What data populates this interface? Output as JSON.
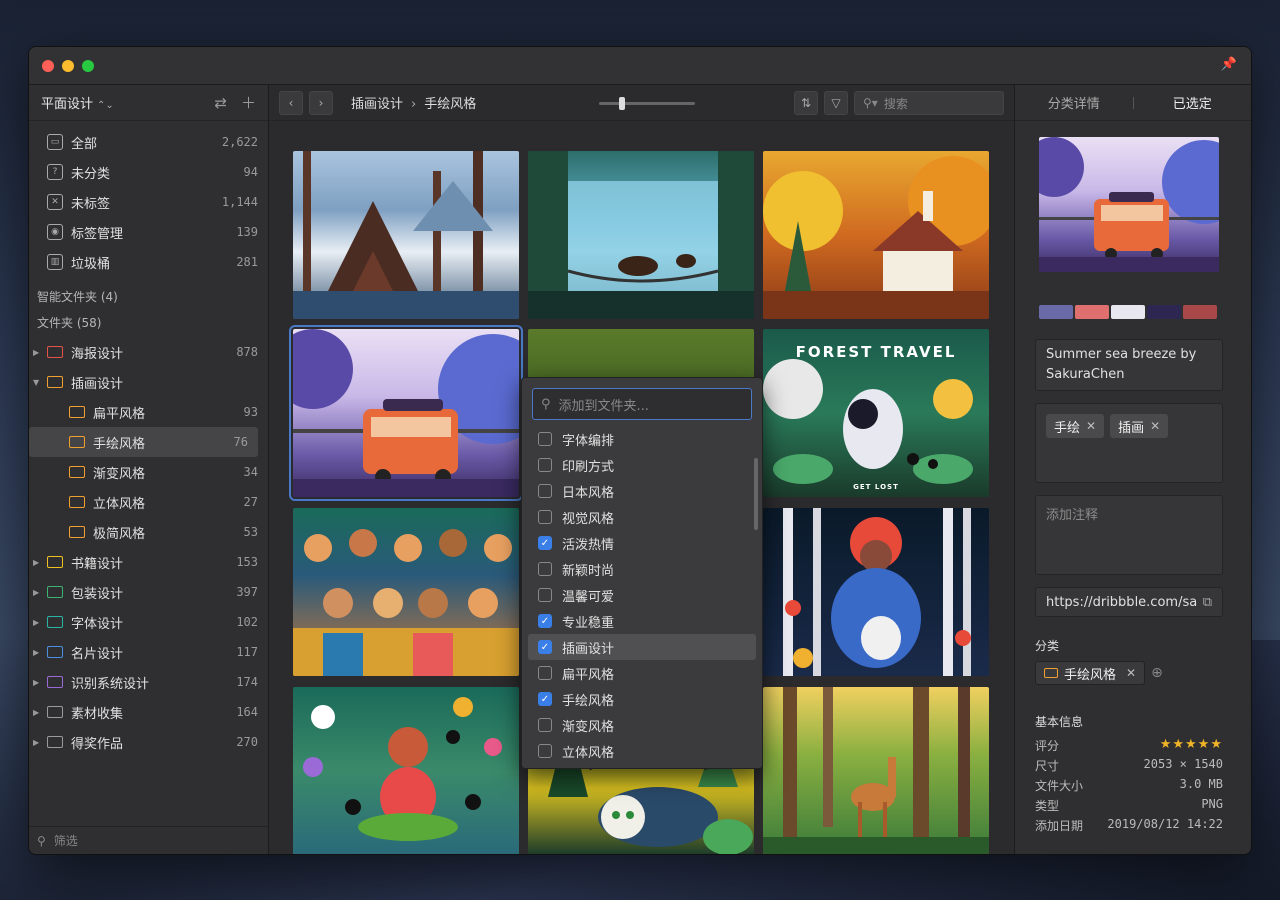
{
  "sidebar": {
    "library": "平面设计",
    "nav": [
      {
        "label": "全部",
        "count": "2,622"
      },
      {
        "label": "未分类",
        "count": "94"
      },
      {
        "label": "未标签",
        "count": "1,144"
      },
      {
        "label": "标签管理",
        "count": "139"
      },
      {
        "label": "垃圾桶",
        "count": "281"
      }
    ],
    "smart_folders": "智能文件夹 (4)",
    "folders_title": "文件夹 (58)",
    "folders": [
      {
        "label": "海报设计",
        "count": "878",
        "color": "#e5544b"
      },
      {
        "label": "插画设计",
        "count": "",
        "color": "#f0a030"
      },
      {
        "label": "扁平风格",
        "count": "93",
        "color": "#f0a030"
      },
      {
        "label": "手绘风格",
        "count": "76",
        "color": "#f0a030"
      },
      {
        "label": "渐变风格",
        "count": "34",
        "color": "#f0a030"
      },
      {
        "label": "立体风格",
        "count": "27",
        "color": "#f0a030"
      },
      {
        "label": "极简风格",
        "count": "53",
        "color": "#f0a030"
      },
      {
        "label": "书籍设计",
        "count": "153",
        "color": "#f0c020"
      },
      {
        "label": "包装设计",
        "count": "397",
        "color": "#3cb371"
      },
      {
        "label": "字体设计",
        "count": "102",
        "color": "#2ab5a5"
      },
      {
        "label": "名片设计",
        "count": "117",
        "color": "#4a8fe0"
      },
      {
        "label": "识别系统设计",
        "count": "174",
        "color": "#9b6ad6"
      },
      {
        "label": "素材收集",
        "count": "164",
        "color": "#9a9a9a"
      },
      {
        "label": "得奖作品",
        "count": "270",
        "color": "#9a9a9a"
      }
    ],
    "filter_placeholder": "筛选"
  },
  "toolbar": {
    "breadcrumb_parent": "插画设计",
    "breadcrumb_current": "手绘风格",
    "search_placeholder": "搜索"
  },
  "dropdown": {
    "placeholder": "添加到文件夹...",
    "items": [
      {
        "label": "字体编排",
        "checked": false
      },
      {
        "label": "印刷方式",
        "checked": false
      },
      {
        "label": "日本风格",
        "checked": false
      },
      {
        "label": "视觉风格",
        "checked": false
      },
      {
        "label": "活泼热情",
        "checked": true
      },
      {
        "label": "新颖时尚",
        "checked": false
      },
      {
        "label": "温馨可爱",
        "checked": false
      },
      {
        "label": "专业稳重",
        "checked": true
      },
      {
        "label": "插画设计",
        "checked": true
      },
      {
        "label": "扁平风格",
        "checked": false
      },
      {
        "label": "手绘风格",
        "checked": true
      },
      {
        "label": "渐变风格",
        "checked": false
      },
      {
        "label": "立体风格",
        "checked": false
      }
    ]
  },
  "grid": {
    "forest_title": "FOREST TRAVEL",
    "forest_sub": "GET LOST"
  },
  "inspector": {
    "tab_details": "分类详情",
    "tab_selected": "已选定",
    "palette": [
      "#6a6aa8",
      "#e07070",
      "#e8e6ee",
      "#2c2650",
      "#a84848"
    ],
    "title": "Summer sea breeze by SakuraChen",
    "tags": [
      "手绘",
      "插画"
    ],
    "note_placeholder": "添加注释",
    "url": "https://dribbble.com/sa",
    "category_title": "分类",
    "category": "手绘风格",
    "info_title": "基本信息",
    "rating_label": "评分",
    "rating": 5,
    "size_label": "尺寸",
    "size": "2053 × 1540",
    "filesize_label": "文件大小",
    "filesize": "3.0 MB",
    "type_label": "类型",
    "type": "PNG",
    "date_label": "添加日期",
    "date": "2019/08/12 14:22"
  }
}
